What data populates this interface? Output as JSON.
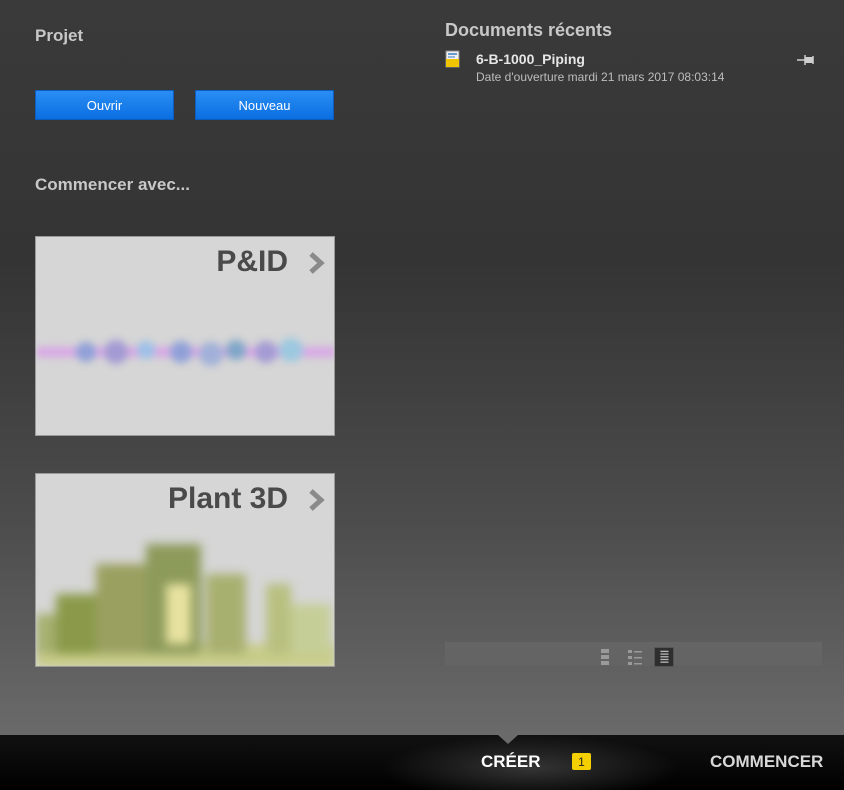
{
  "project": {
    "title": "Projet",
    "open_label": "Ouvrir",
    "new_label": "Nouveau"
  },
  "start_with": {
    "title": "Commencer avec...",
    "tiles": [
      {
        "label": "P&ID",
        "icon": "chevron-right-icon"
      },
      {
        "label": "Plant 3D",
        "icon": "chevron-right-icon"
      }
    ]
  },
  "recent_documents": {
    "title": "Documents récents",
    "items": [
      {
        "name": "6-B-1000_Piping",
        "date": "Date d'ouverture mardi 21 mars 2017 08:03:14",
        "icon": "drawing-file-icon",
        "pin_icon": "pin-icon"
      }
    ],
    "view_modes": [
      "view-tiles-icon",
      "view-details-icon",
      "view-list-icon"
    ]
  },
  "bottom_tabs": {
    "create_label": "CRÉER",
    "notification_count": "1",
    "start_label": "COMMENCER"
  },
  "colors": {
    "button_blue": "#0a6ee0",
    "badge_yellow": "#f5d000",
    "background": "#3a3a3a"
  }
}
